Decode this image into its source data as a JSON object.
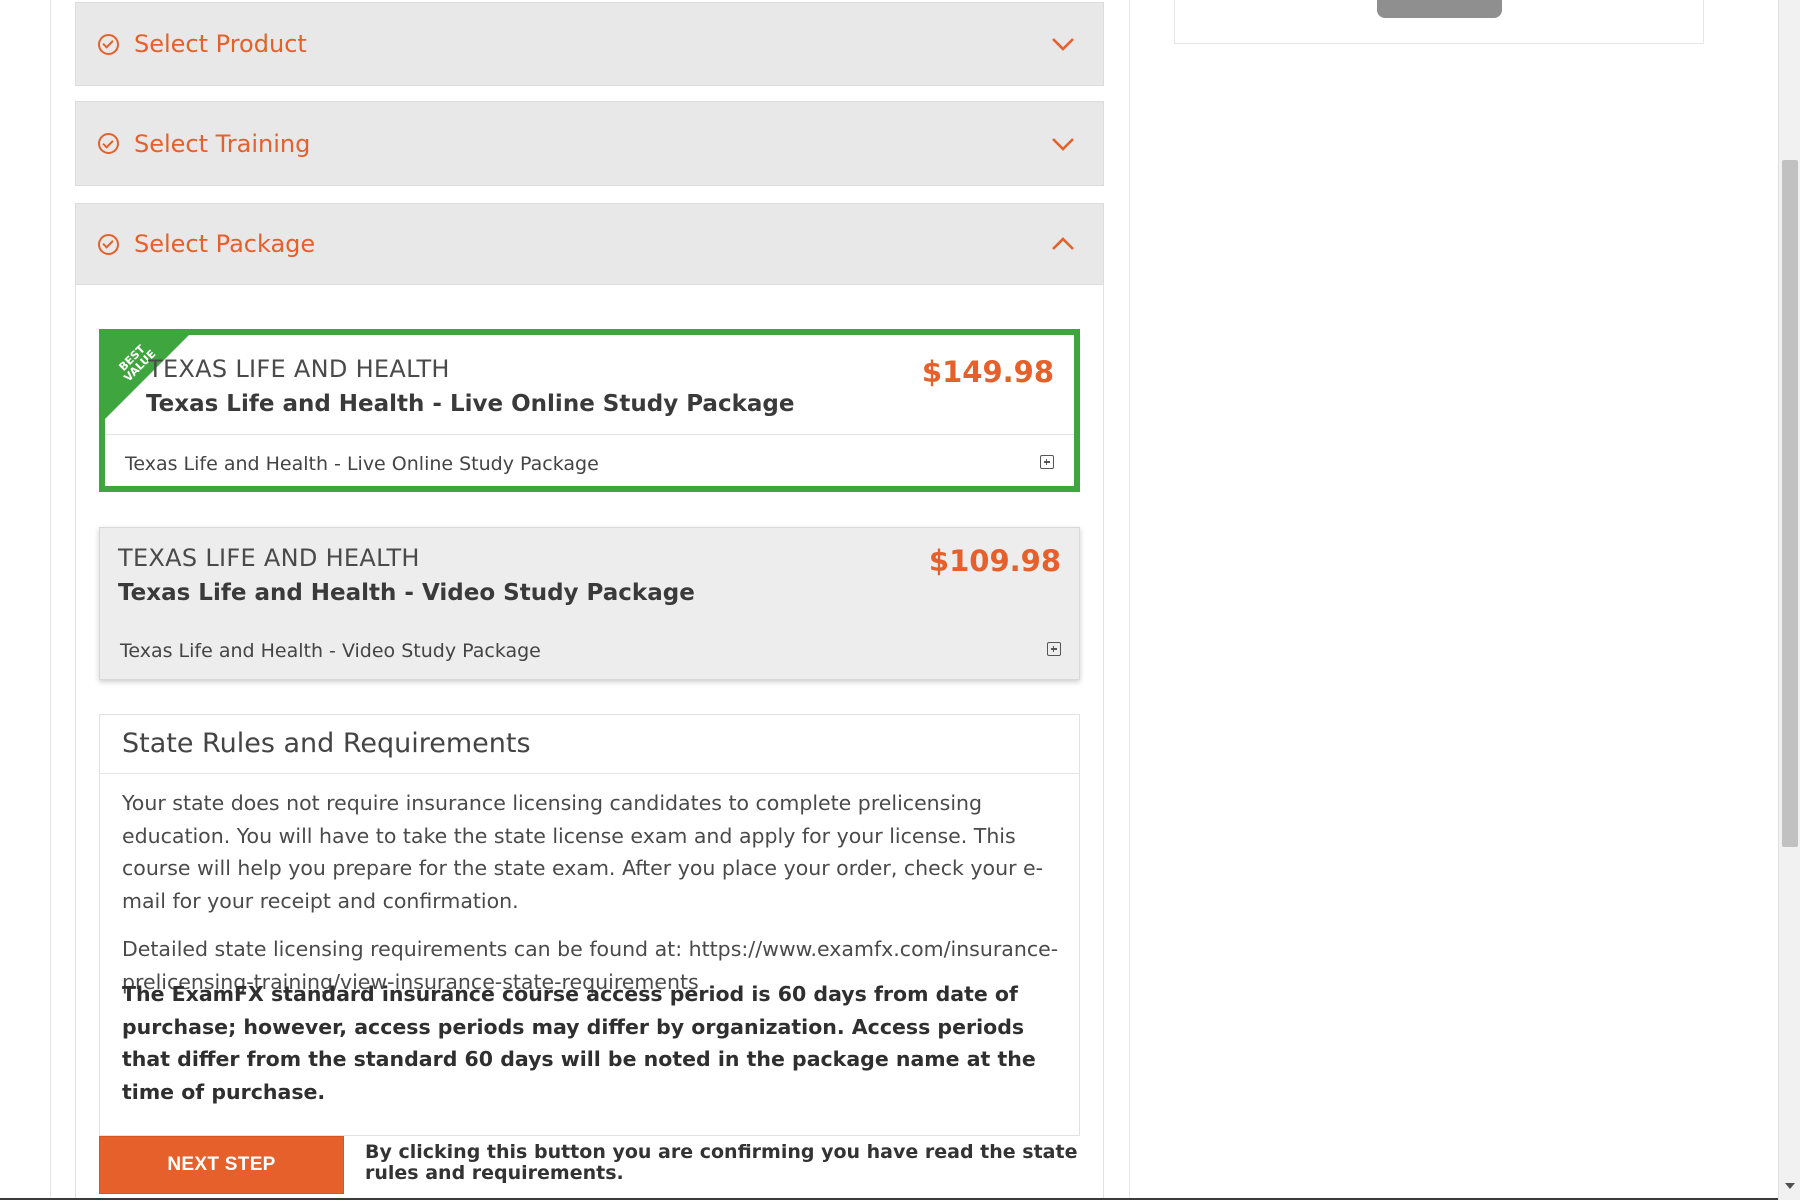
{
  "accordion": {
    "sections": [
      {
        "label": "Select Product",
        "state": "collapsed"
      },
      {
        "label": "Select Training",
        "state": "collapsed"
      },
      {
        "label": "Select Package",
        "state": "expanded"
      }
    ]
  },
  "packages": [
    {
      "ribbon": "BEST VALUE",
      "state_label": "TEXAS LIFE AND HEALTH",
      "name": "Texas Life and Health - Live Online Study Package",
      "price": "$149.98",
      "description": "Texas Life and Health - Live Online Study Package",
      "selected": true
    },
    {
      "state_label": "TEXAS LIFE AND HEALTH",
      "name": "Texas Life and Health - Video Study Package",
      "price": "$109.98",
      "description": "Texas Life and Health - Video Study Package",
      "selected": false
    }
  ],
  "rules": {
    "title": "State Rules and Requirements",
    "paragraph1": "Your state does not require insurance licensing candidates to complete prelicensing education. You will have to take the state license exam and apply for your license. This course will help you prepare for the state exam. After you place your order, check your e-mail for your receipt and confirmation.",
    "paragraph2": "Detailed state licensing requirements can be found at: https://www.examfx.com/insurance-prelicensing-training/view-insurance-state-requirements",
    "paragraph3": "The ExamFX standard insurance course access period is 60 days from date of purchase; however, access periods may differ by organization. Access periods that differ from the standard 60 days will be noted in the package name at the time of purchase."
  },
  "actions": {
    "next_label": "NEXT STEP",
    "confirm_text": "By clicking this button you are confirming you have read the state rules and requirements."
  },
  "colors": {
    "accent": "#e5602a",
    "selected_border": "#3fa63f",
    "header_bg": "#e8e8e8"
  },
  "icons": {
    "section_status": "check-circle-icon",
    "collapsed": "chevron-down-icon",
    "expanded": "chevron-up-icon",
    "expand_details": "plus-square-icon"
  }
}
